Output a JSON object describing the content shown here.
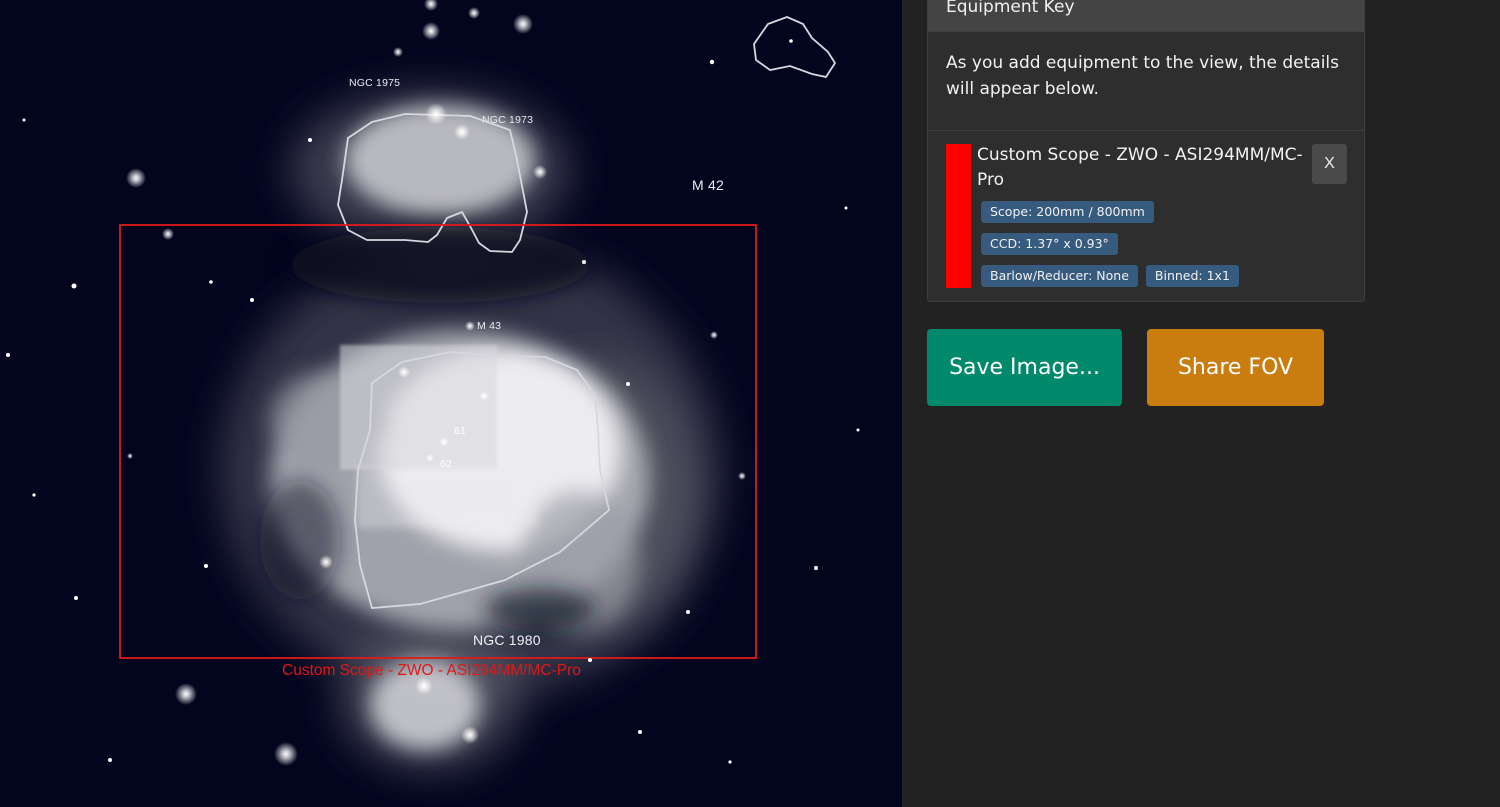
{
  "sky": {
    "labels": {
      "ngc1975": "NGC 1975",
      "ngc1973": "NGC 1973",
      "m42": "M 42",
      "m43": "M 43",
      "num61": "61",
      "num62": "62",
      "ngc1980": "NGC 1980"
    },
    "fov_label": "Custom Scope - ZWO - ASI294MM/MC-Pro",
    "fov_color": "#ff0000",
    "background_color": "#03051f"
  },
  "panel": {
    "header": "Equipment Key",
    "intro": "As you add equipment to the view, the details will appear below.",
    "equipment": {
      "name": "Custom Scope - ZWO - ASI294MM/MC-Pro",
      "color": "#ff0000",
      "remove_label": "X",
      "badges": {
        "scope": "Scope: 200mm / 800mm",
        "ccd": "CCD: 1.37° x 0.93°",
        "barlow": "Barlow/Reducer: None",
        "binned": "Binned: 1x1"
      }
    },
    "buttons": {
      "save": "Save Image...",
      "share": "Share FOV"
    },
    "colors": {
      "save_button": "#00896a",
      "share_button": "#c97d0e",
      "badge": "#375a7f",
      "panel_bg": "#222222"
    }
  }
}
